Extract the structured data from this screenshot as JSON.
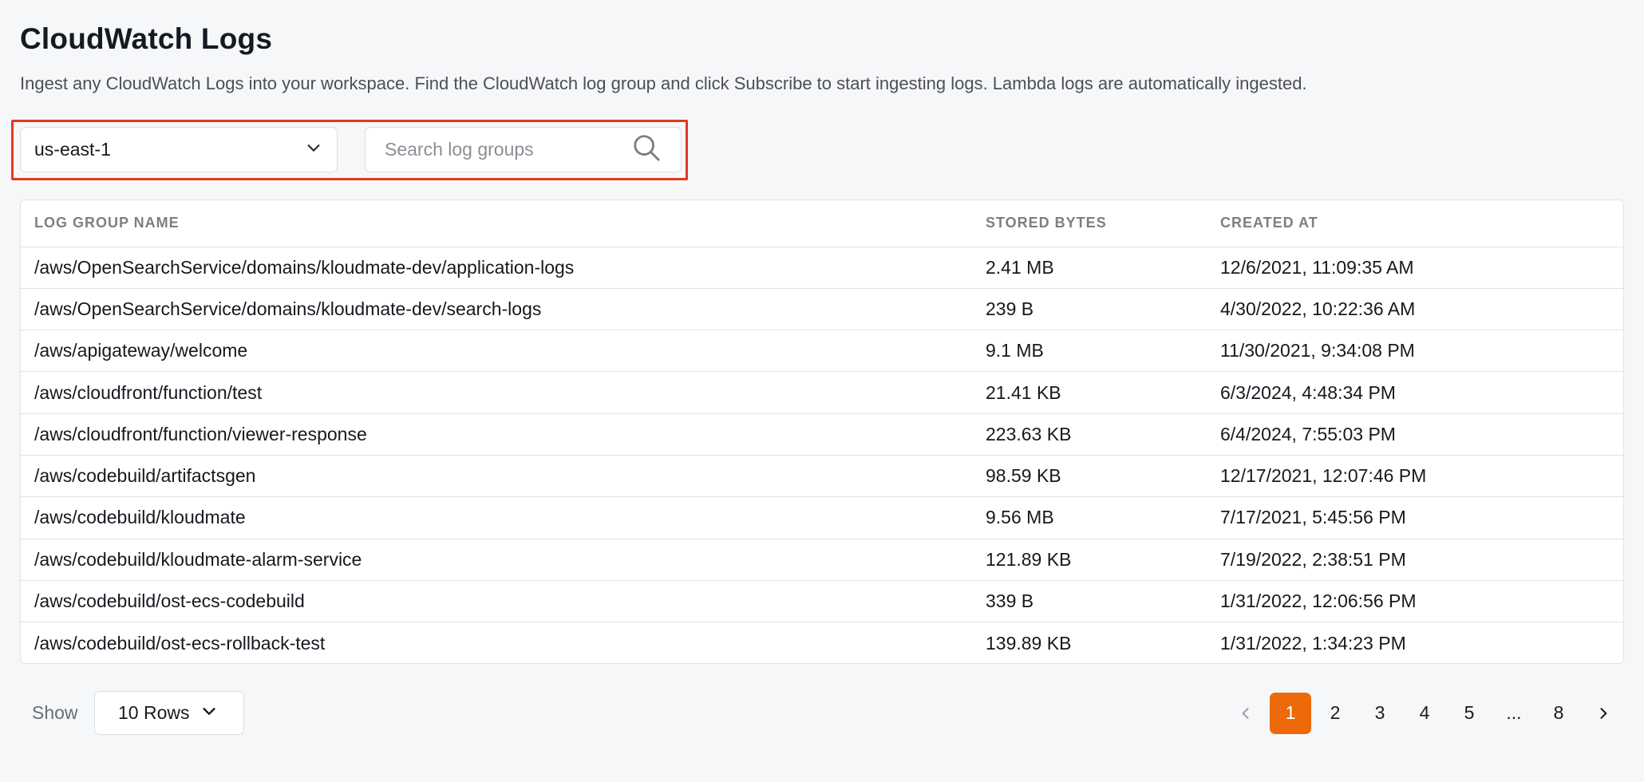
{
  "header": {
    "title": "CloudWatch Logs",
    "description": "Ingest any CloudWatch Logs into your workspace. Find the CloudWatch log group and click Subscribe to start ingesting logs. Lambda logs are automatically ingested."
  },
  "filters": {
    "region": "us-east-1",
    "search_placeholder": "Search log groups",
    "search_value": ""
  },
  "table": {
    "columns": [
      "LOG GROUP NAME",
      "STORED BYTES",
      "CREATED AT"
    ],
    "rows": [
      {
        "name": "/aws/OpenSearchService/domains/kloudmate-dev/application-logs",
        "bytes": "2.41 MB",
        "created": "12/6/2021, 11:09:35 AM"
      },
      {
        "name": "/aws/OpenSearchService/domains/kloudmate-dev/search-logs",
        "bytes": "239 B",
        "created": "4/30/2022, 10:22:36 AM"
      },
      {
        "name": "/aws/apigateway/welcome",
        "bytes": "9.1 MB",
        "created": "11/30/2021, 9:34:08 PM"
      },
      {
        "name": "/aws/cloudfront/function/test",
        "bytes": "21.41 KB",
        "created": "6/3/2024, 4:48:34 PM"
      },
      {
        "name": "/aws/cloudfront/function/viewer-response",
        "bytes": "223.63 KB",
        "created": "6/4/2024, 7:55:03 PM"
      },
      {
        "name": "/aws/codebuild/artifactsgen",
        "bytes": "98.59 KB",
        "created": "12/17/2021, 12:07:46 PM"
      },
      {
        "name": "/aws/codebuild/kloudmate",
        "bytes": "9.56 MB",
        "created": "7/17/2021, 5:45:56 PM"
      },
      {
        "name": "/aws/codebuild/kloudmate-alarm-service",
        "bytes": "121.89 KB",
        "created": "7/19/2022, 2:38:51 PM"
      },
      {
        "name": "/aws/codebuild/ost-ecs-codebuild",
        "bytes": "339 B",
        "created": "1/31/2022, 12:06:56 PM"
      },
      {
        "name": "/aws/codebuild/ost-ecs-rollback-test",
        "bytes": "139.89 KB",
        "created": "1/31/2022, 1:34:23 PM"
      }
    ]
  },
  "footer": {
    "show_label": "Show",
    "rows_per_page": "10 Rows",
    "pages": [
      "1",
      "2",
      "3",
      "4",
      "5",
      "...",
      "8"
    ],
    "current_page": "1"
  },
  "colors": {
    "accent": "#ec6a0a",
    "highlight_border": "#e3381f"
  },
  "icons": {
    "region_chevron": "chevron-down-icon",
    "search": "search-icon",
    "rows_chevron": "chevron-down-icon",
    "prev": "chevron-left-icon",
    "next": "chevron-right-icon"
  }
}
